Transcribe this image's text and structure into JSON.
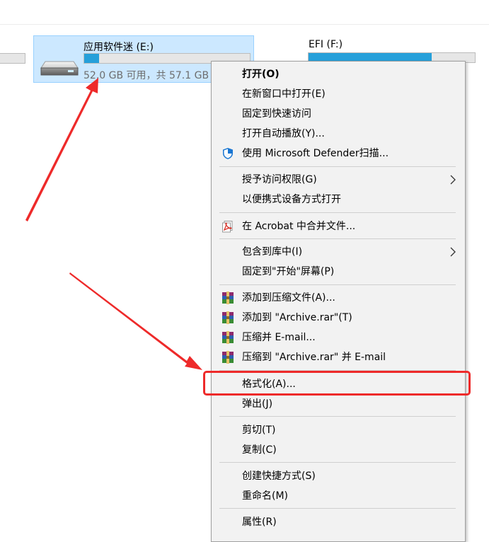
{
  "drives": [
    {
      "name": "应用软件迷 (E:)",
      "space_text": "52.0 GB 可用，共 57.1 GB",
      "used_fraction": 0.09,
      "selected": true
    },
    {
      "name": "EFI (F:)",
      "used_fraction": 0.74,
      "selected": false
    }
  ],
  "menu": {
    "items": [
      {
        "label": "打开(O)",
        "bold": true
      },
      {
        "label": "在新窗口中打开(E)"
      },
      {
        "label": "固定到快速访问"
      },
      {
        "label": "打开自动播放(Y)..."
      },
      {
        "label": "使用 Microsoft Defender扫描...",
        "icon": "defender-shield-icon"
      },
      {
        "label": "授予访问权限(G)",
        "submenu": true
      },
      {
        "label": "以便携式设备方式打开"
      },
      {
        "label": "在 Acrobat 中合并文件...",
        "icon": "acrobat-icon"
      },
      {
        "label": "包含到库中(I)",
        "submenu": true
      },
      {
        "label": "固定到\"开始\"屏幕(P)"
      },
      {
        "label": "添加到压缩文件(A)...",
        "icon": "winrar-icon"
      },
      {
        "label": "添加到 \"Archive.rar\"(T)",
        "icon": "winrar-icon"
      },
      {
        "label": "压缩并 E-mail...",
        "icon": "winrar-icon"
      },
      {
        "label": "压缩到 \"Archive.rar\" 并 E-mail",
        "icon": "winrar-icon"
      },
      {
        "label": "格式化(A)...",
        "highlighted": true
      },
      {
        "label": "弹出(J)"
      },
      {
        "label": "剪切(T)"
      },
      {
        "label": "复制(C)"
      },
      {
        "label": "创建快捷方式(S)"
      },
      {
        "label": "重命名(M)"
      },
      {
        "label": "属性(R)"
      }
    ]
  },
  "colors": {
    "selection_bg": "#cce8ff",
    "selection_border": "#99d1ff",
    "progress_fill": "#26a0da",
    "annotation_red": "#ee2a2a",
    "menu_bg": "#f2f2f2"
  }
}
